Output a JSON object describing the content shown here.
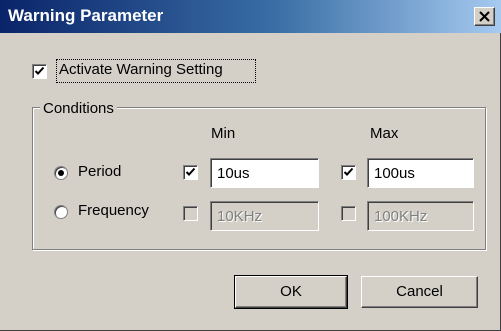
{
  "window": {
    "title": "Warning Parameter"
  },
  "activate": {
    "label": "Activate Warning Setting",
    "checked": true
  },
  "conditions": {
    "group_label": "Conditions",
    "min_header": "Min",
    "max_header": "Max",
    "rows": [
      {
        "label": "Period",
        "selected": true,
        "min_checked": true,
        "min_value": "10us",
        "max_checked": true,
        "max_value": "100us",
        "enabled": true
      },
      {
        "label": "Frequency",
        "selected": false,
        "min_checked": false,
        "min_value": "10KHz",
        "max_checked": false,
        "max_value": "100KHz",
        "enabled": false
      }
    ]
  },
  "buttons": {
    "ok": "OK",
    "cancel": "Cancel"
  }
}
